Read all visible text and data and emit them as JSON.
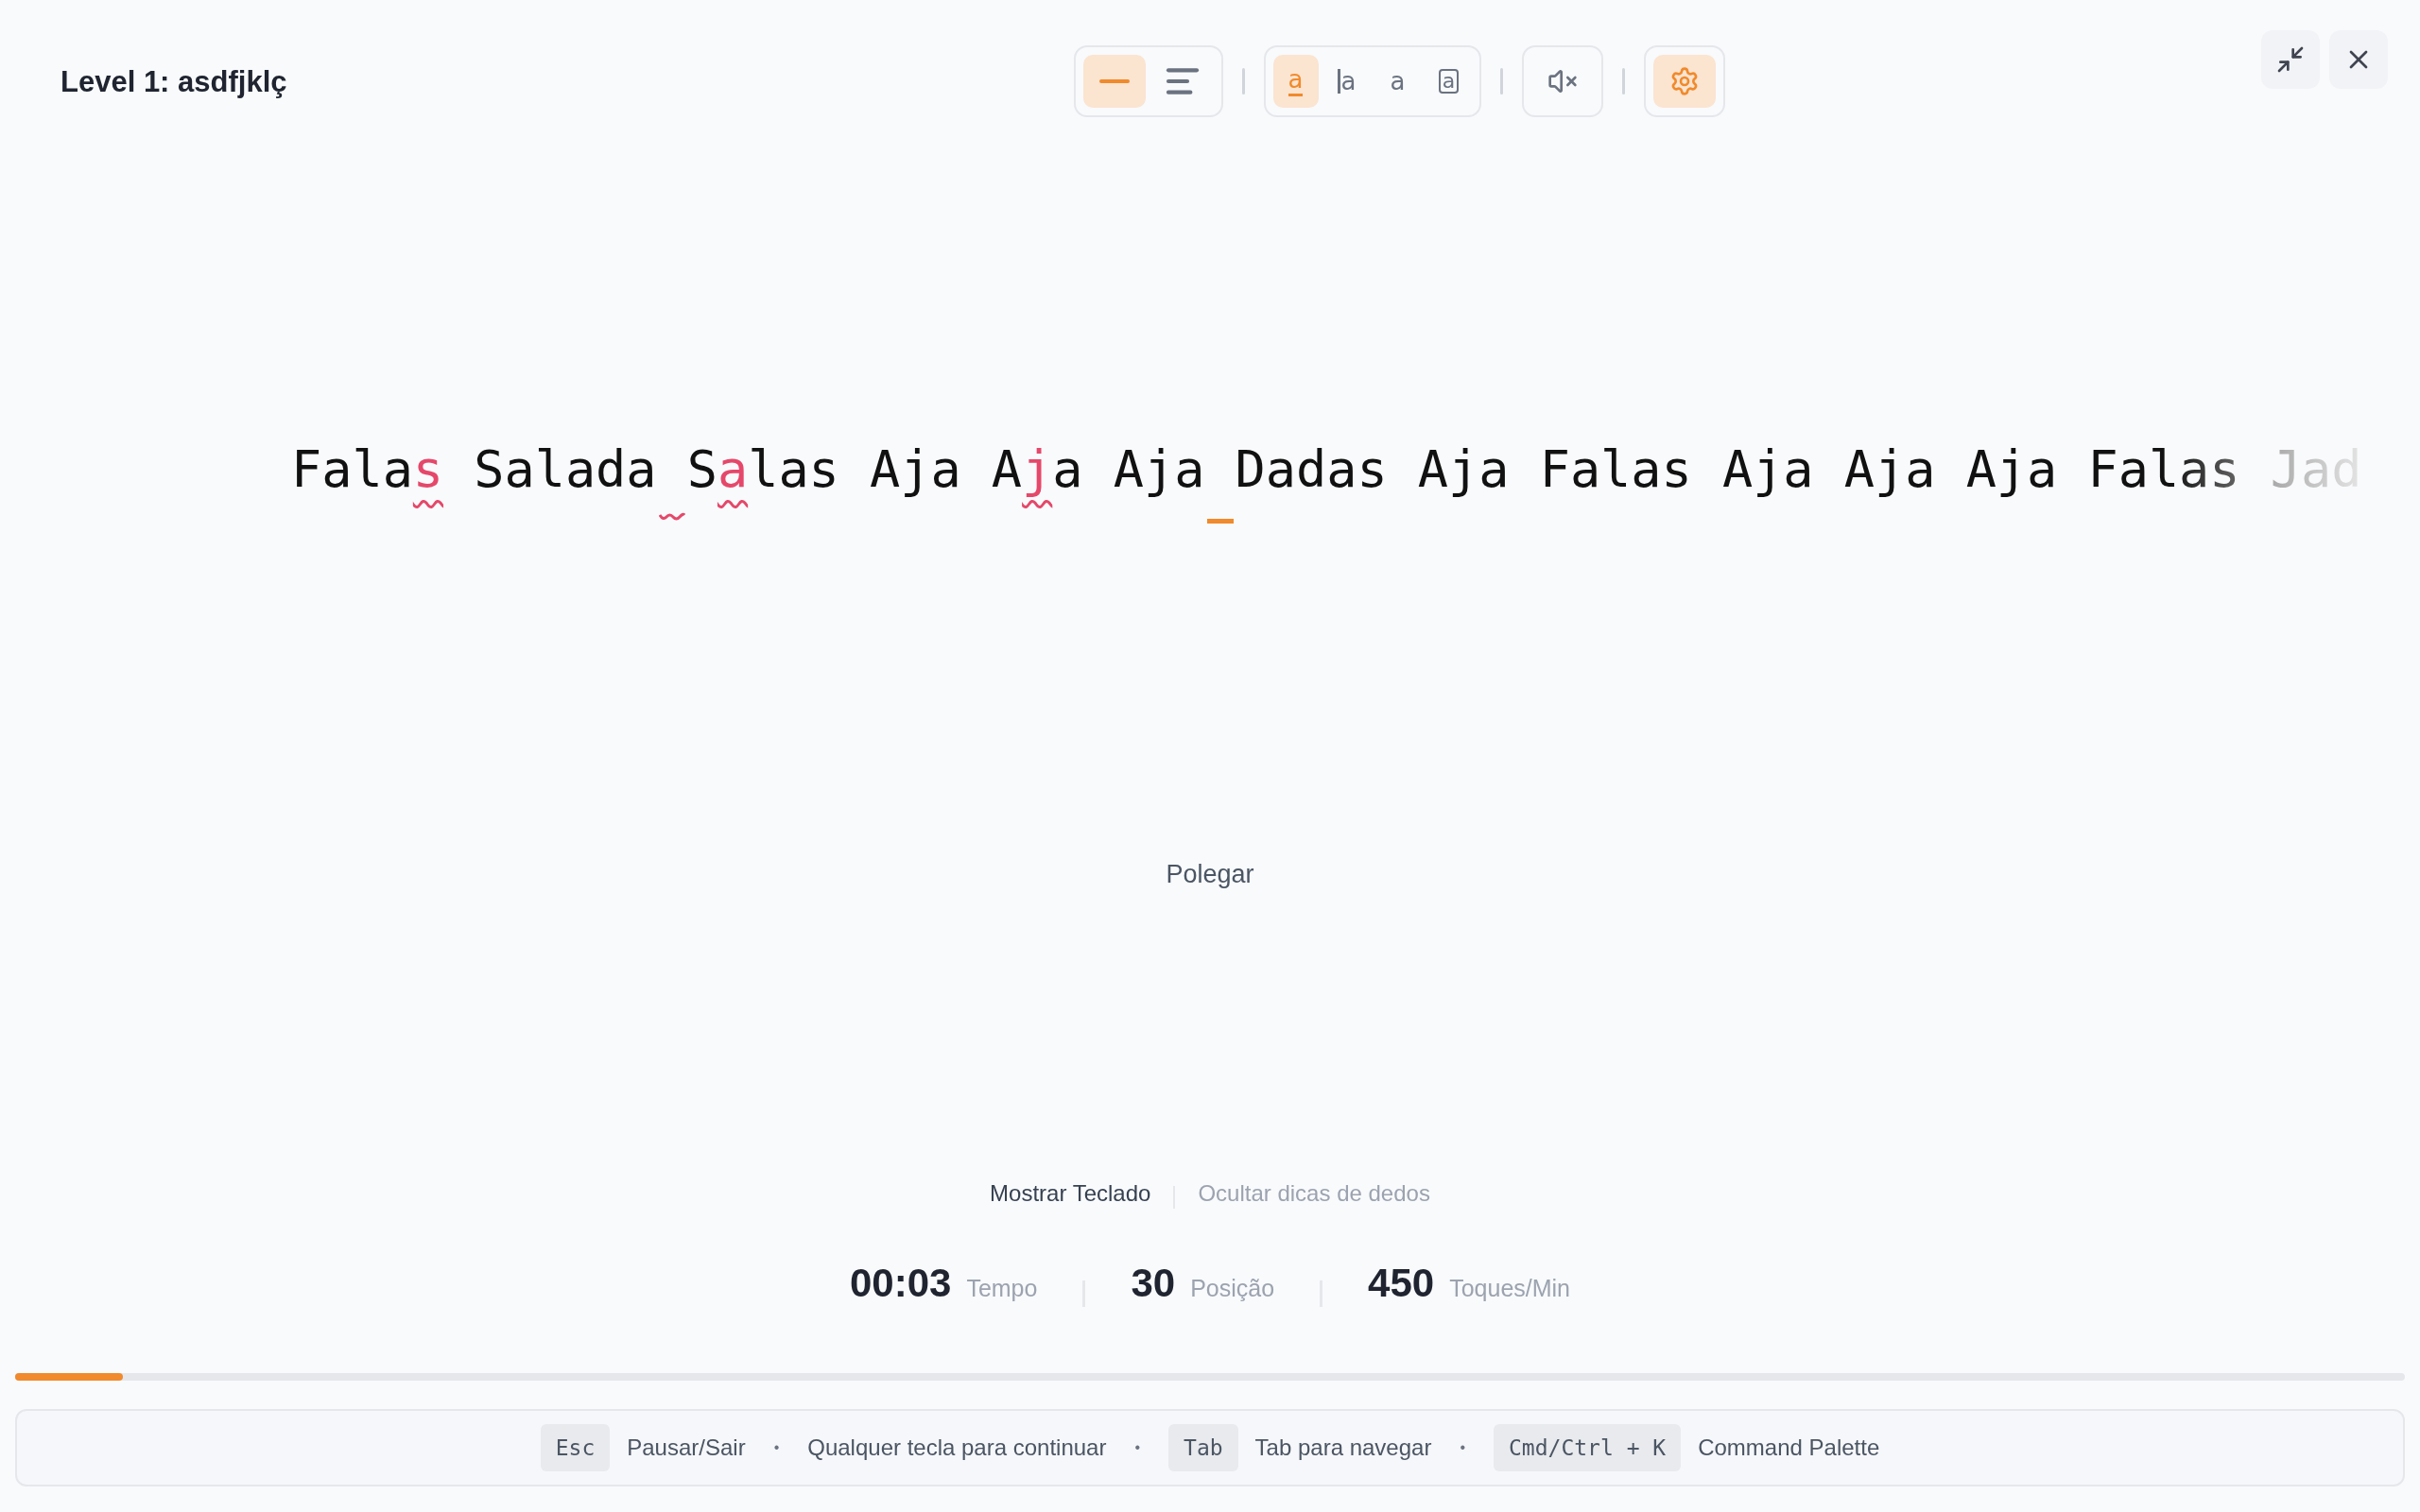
{
  "title": "Level 1: asdfjklç",
  "toolbar": {
    "groups": [
      {
        "items": [
          {
            "selected": true
          },
          {
            "selected": false
          }
        ]
      },
      {
        "items": [
          {
            "glyph": "a",
            "selected": true
          },
          {
            "glyph": "a",
            "selected": false
          },
          {
            "glyph": "a",
            "selected": false
          },
          {
            "glyph": "a",
            "selected": false
          }
        ]
      },
      {
        "items": [
          {
            "selected": false
          }
        ]
      },
      {
        "items": [
          {
            "selected": true
          }
        ]
      }
    ]
  },
  "typing_words": [
    {
      "parts": [
        {
          "text": "Fala",
          "error": false
        },
        {
          "text": "s",
          "error": true
        }
      ],
      "space_error": false,
      "cursor": false
    },
    {
      "parts": [
        {
          "text": "Salada",
          "error": false
        }
      ],
      "space_error": true,
      "cursor": false
    },
    {
      "parts": [
        {
          "text": "S",
          "error": false
        },
        {
          "text": "a",
          "error": true
        },
        {
          "text": "las",
          "error": false
        }
      ],
      "space_error": false,
      "cursor": false
    },
    {
      "parts": [
        {
          "text": "Aja",
          "error": false
        }
      ],
      "space_error": false,
      "cursor": false
    },
    {
      "parts": [
        {
          "text": "A",
          "error": false
        },
        {
          "text": "j",
          "error": true
        },
        {
          "text": "a",
          "error": false
        }
      ],
      "space_error": false,
      "cursor": false
    },
    {
      "parts": [
        {
          "text": "Aja",
          "error": false
        }
      ],
      "space_error": false,
      "cursor": true
    },
    {
      "parts": [
        {
          "text": "Dadas",
          "error": false
        }
      ],
      "space_error": false,
      "cursor": false
    },
    {
      "parts": [
        {
          "text": "Aja",
          "error": false
        }
      ],
      "space_error": false,
      "cursor": false
    },
    {
      "parts": [
        {
          "text": "Falas",
          "error": false
        }
      ],
      "space_error": false,
      "cursor": false
    },
    {
      "parts": [
        {
          "text": "Aja",
          "error": false
        }
      ],
      "space_error": false,
      "cursor": false
    },
    {
      "parts": [
        {
          "text": "Aja",
          "error": false
        }
      ],
      "space_error": false,
      "cursor": false
    },
    {
      "parts": [
        {
          "text": "Aja",
          "error": false
        }
      ],
      "space_error": false,
      "cursor": false
    },
    {
      "parts": [
        {
          "text": "Falas",
          "error": false
        }
      ],
      "space_error": false,
      "cursor": false
    },
    {
      "parts": [
        {
          "text": "Jad",
          "error": false
        }
      ],
      "space_error": false,
      "cursor": false
    }
  ],
  "finger_hint": "Polegar",
  "toggles": [
    {
      "label": "Mostrar Teclado",
      "active": true
    },
    {
      "label": "Ocultar dicas de dedos",
      "active": false
    }
  ],
  "stats": [
    {
      "value": "00:03",
      "label": "Tempo"
    },
    {
      "value": "30",
      "label": "Posição"
    },
    {
      "value": "450",
      "label": "Toques/Min"
    }
  ],
  "progress": {
    "level": 0.045
  },
  "footer": [
    {
      "kind": "shortcut",
      "key": "Esc",
      "label": "Pausar/Sair"
    },
    {
      "kind": "dot",
      "text": "•"
    },
    {
      "kind": "text",
      "text": "Qualquer tecla para continuar"
    },
    {
      "kind": "dot",
      "text": "•"
    },
    {
      "kind": "shortcut",
      "key": "Tab",
      "label": "Tab para navegar"
    },
    {
      "kind": "dot",
      "text": "•"
    },
    {
      "kind": "shortcut",
      "key": "Cmd/Ctrl + K",
      "label": "Command Palette"
    }
  ]
}
